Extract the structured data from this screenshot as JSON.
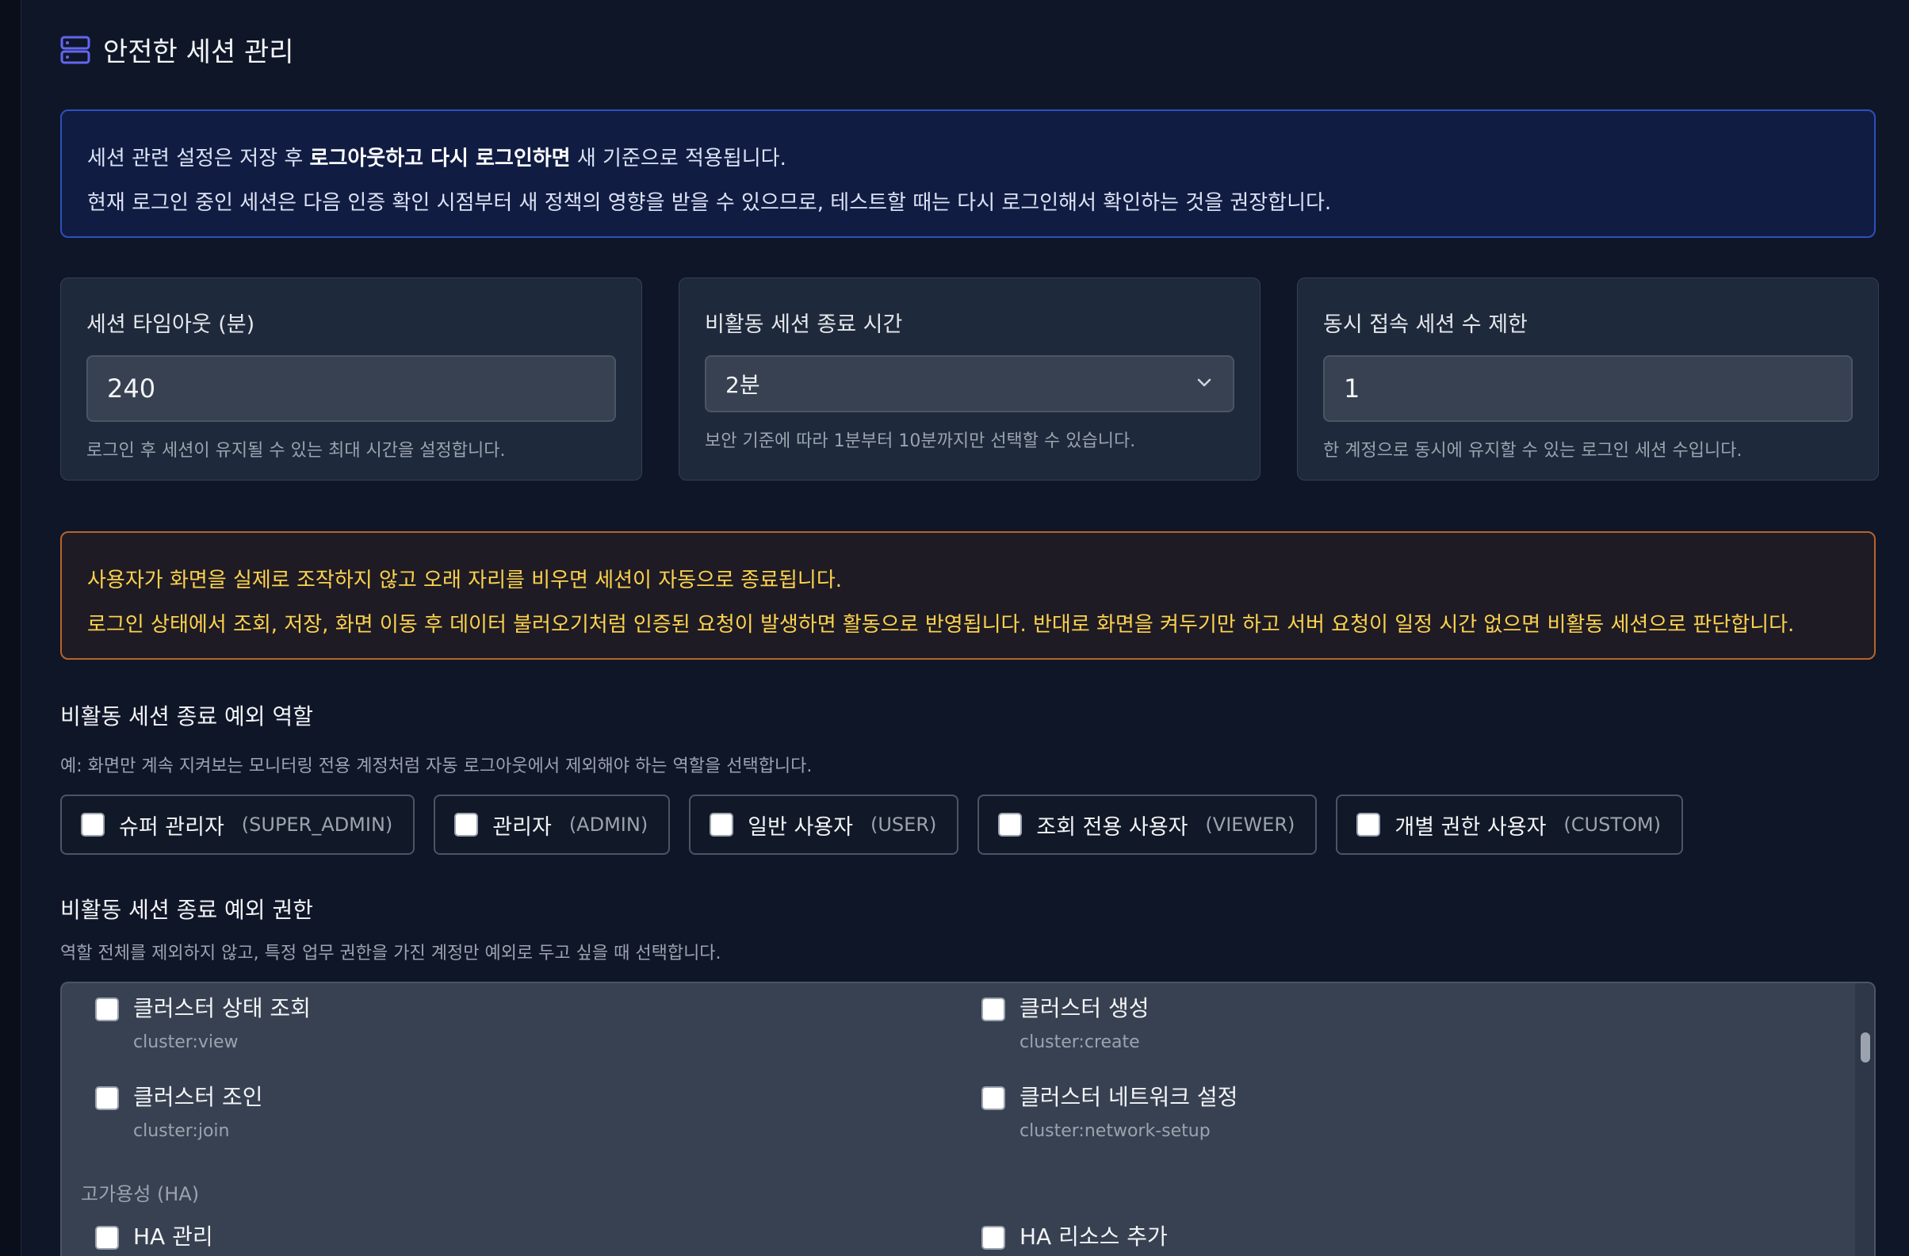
{
  "section": {
    "title": "안전한 세션 관리",
    "icon": "server-icon",
    "accent_color": "#6366f1"
  },
  "info": {
    "line1_pre": "세션 관련 설정은 저장 후 ",
    "line1_bold": "로그아웃하고 다시 로그인하면",
    "line1_post": " 새 기준으로 적용됩니다.",
    "line2": "현재 로그인 중인 세션은 다음 인증 확인 시점부터 새 정책의 영향을 받을 수 있으므로, 테스트할 때는 다시 로그인해서 확인하는 것을 권장합니다."
  },
  "cards": {
    "timeout": {
      "label": "세션 타임아웃 (분)",
      "value": "240",
      "help": "로그인 후 세션이 유지될 수 있는 최대 시간을 설정합니다."
    },
    "idle": {
      "label": "비활동 세션 종료 시간",
      "selected": "2분",
      "help": "보안 기준에 따라 1분부터 10분까지만 선택할 수 있습니다."
    },
    "concurrent": {
      "label": "동시 접속 세션 수 제한",
      "value": "1",
      "help": "한 계정으로 동시에 유지할 수 있는 로그인 세션 수입니다."
    }
  },
  "warning": {
    "line1": "사용자가 화면을 실제로 조작하지 않고 오래 자리를 비우면 세션이 자동으로 종료됩니다.",
    "line2": "로그인 상태에서 조회, 저장, 화면 이동 후 데이터 불러오기처럼 인증된 요청이 발생하면 활동으로 반영됩니다. 반대로 화면을 켜두기만 하고 서버 요청이 일정 시간 없으면 비활동 세션으로 판단합니다."
  },
  "roles": {
    "title": "비활동 세션 종료 예외 역할",
    "help": "예: 화면만 계속 지켜보는 모니터링 전용 계정처럼 자동 로그아웃에서 제외해야 하는 역할을 선택합니다.",
    "items": [
      {
        "label": "슈퍼 관리자",
        "code": "(SUPER_ADMIN)"
      },
      {
        "label": "관리자",
        "code": "(ADMIN)"
      },
      {
        "label": "일반 사용자",
        "code": "(USER)"
      },
      {
        "label": "조회 전용 사용자",
        "code": "(VIEWER)"
      },
      {
        "label": "개별 권한 사용자",
        "code": "(CUSTOM)"
      }
    ]
  },
  "permissions": {
    "title": "비활동 세션 종료 예외 권한",
    "help": "역할 전체를 제외하지 않고, 특정 업무 권한을 가진 계정만 예외로 두고 싶을 때 선택합니다.",
    "items": [
      {
        "name": "클러스터 상태 조회",
        "code": "cluster:view"
      },
      {
        "name": "클러스터 생성",
        "code": "cluster:create"
      },
      {
        "name": "클러스터 조인",
        "code": "cluster:join"
      },
      {
        "name": "클러스터 네트워크 설정",
        "code": "cluster:network-setup"
      }
    ],
    "group_ha": "고가용성 (HA)",
    "ha_items": [
      {
        "name": "HA 관리"
      },
      {
        "name": "HA 리소스 추가"
      }
    ]
  }
}
